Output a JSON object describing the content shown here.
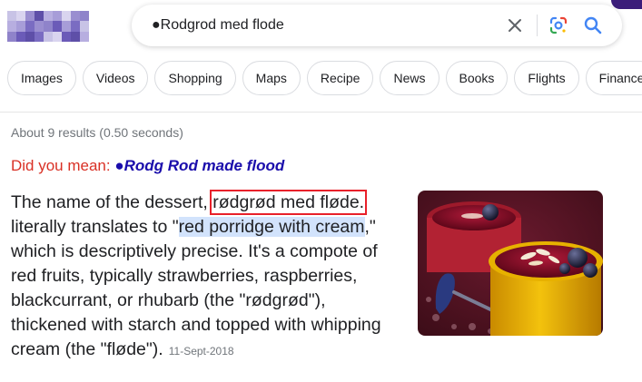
{
  "logo": {
    "palette": [
      "#c8c3e6",
      "#9a8ed0",
      "#6b5bb8",
      "#b7aee0",
      "#7a6cc2",
      "#d9d4ef",
      "#8f83ca",
      "#5e4fa8",
      "#a79dd8"
    ]
  },
  "search": {
    "query": "●Rodgrod med flode",
    "icons": [
      "close-icon",
      "google-lens-icon",
      "search-icon"
    ]
  },
  "chips": [
    "Images",
    "Videos",
    "Shopping",
    "Maps",
    "Recipe",
    "News",
    "Books",
    "Flights",
    "Finance"
  ],
  "result_stats": "About 9 results (0.50 seconds)",
  "did_you_mean": {
    "label": "Did you mean:",
    "suggestion": "●Rodg Rod made flood"
  },
  "snippet": {
    "part1": "The name of the dessert,",
    "boxed_term": "rødgrød med fløde.",
    "part2": "literally translates to \"",
    "highlight": "red porridge with cream",
    "part3": ",\" which is descriptively precise. It's a compote of red fruits, typically strawberries, raspberries, blackcurrant, or rhubarb (the \"rødgrød\"), thickened with starch and topped with whipping cream (the \"fløde\").",
    "date": "11-Sept-2018"
  },
  "colors": {
    "accent_red": "#d93025",
    "link_blue": "#1a0dab",
    "highlight_blue": "#d2e3fc",
    "annotation_box": "#e8202a",
    "corner_purple": "#3b1d7a"
  }
}
